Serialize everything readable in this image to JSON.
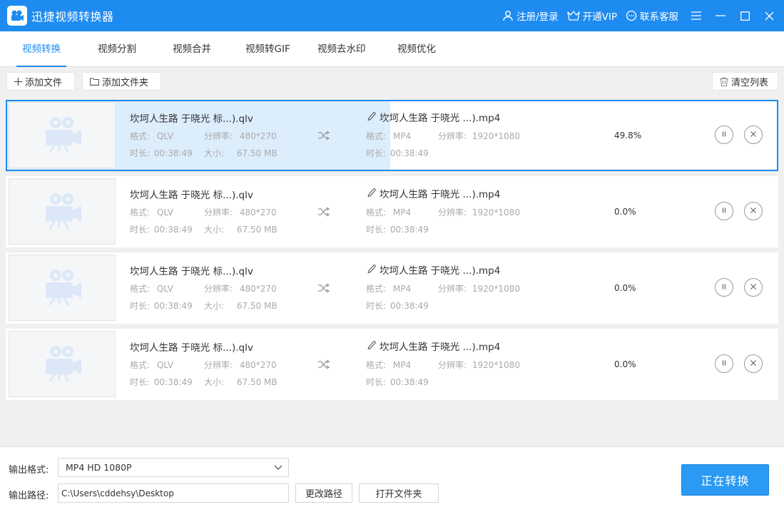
{
  "app": {
    "title": "迅捷视频转换器"
  },
  "header": {
    "login": "注册/登录",
    "vip": "开通VIP",
    "support": "联系客服"
  },
  "tabs": [
    {
      "label": "视频转换",
      "active": true
    },
    {
      "label": "视频分割",
      "active": false
    },
    {
      "label": "视频合并",
      "active": false
    },
    {
      "label": "视频转GIF",
      "active": false
    },
    {
      "label": "视频去水印",
      "active": false
    },
    {
      "label": "视频优化",
      "active": false
    }
  ],
  "toolbar": {
    "add_file": "添加文件",
    "add_folder": "添加文件夹",
    "clear_list": "清空列表"
  },
  "files": [
    {
      "source_name": "坎坷人生路 于晓光 标...).qlv",
      "format_label": "格式:",
      "format": "QLV",
      "resolution_label": "分辨率:",
      "resolution": "480*270",
      "duration_label": "时长:",
      "duration": "00:38:49",
      "size_label": "大小:",
      "size": "67.50 MB",
      "output_name": "坎坷人生路 于晓光 ...).mp4",
      "out_format": "MP4",
      "out_resolution": "1920*1080",
      "out_duration": "00:38:49",
      "progress": "49.8%",
      "progress_value": 0.498
    },
    {
      "source_name": "坎坷人生路 于晓光 标...).qlv",
      "format_label": "格式:",
      "format": "QLV",
      "resolution_label": "分辨率:",
      "resolution": "480*270",
      "duration_label": "时长:",
      "duration": "00:38:49",
      "size_label": "大小:",
      "size": "67.50 MB",
      "output_name": "坎坷人生路 于晓光 ...).mp4",
      "out_format": "MP4",
      "out_resolution": "1920*1080",
      "out_duration": "00:38:49",
      "progress": "0.0%",
      "progress_value": 0
    },
    {
      "source_name": "坎坷人生路 于晓光 标...).qlv",
      "format_label": "格式:",
      "format": "QLV",
      "resolution_label": "分辨率:",
      "resolution": "480*270",
      "duration_label": "时长:",
      "duration": "00:38:49",
      "size_label": "大小:",
      "size": "67.50 MB",
      "output_name": "坎坷人生路 于晓光 ...).mp4",
      "out_format": "MP4",
      "out_resolution": "1920*1080",
      "out_duration": "00:38:49",
      "progress": "0.0%",
      "progress_value": 0
    },
    {
      "source_name": "坎坷人生路 于晓光 标...).qlv",
      "format_label": "格式:",
      "format": "QLV",
      "resolution_label": "分辨率:",
      "resolution": "480*270",
      "duration_label": "时长:",
      "duration": "00:38:49",
      "size_label": "大小:",
      "size": "67.50 MB",
      "output_name": "坎坷人生路 于晓光 ...).mp4",
      "out_format": "MP4",
      "out_resolution": "1920*1080",
      "out_duration": "00:38:49",
      "progress": "0.0%",
      "progress_value": 0
    }
  ],
  "bottom": {
    "format_label": "输出格式:",
    "format_value": "MP4  HD 1080P",
    "path_label": "输出路径:",
    "path_value": "C:\\Users\\cddehsy\\Desktop",
    "change_path": "更改路径",
    "open_folder": "打开文件夹",
    "convert": "正在转换"
  },
  "colors": {
    "accent": "#1e8bf0",
    "progress_fill": "#dcedfc"
  }
}
